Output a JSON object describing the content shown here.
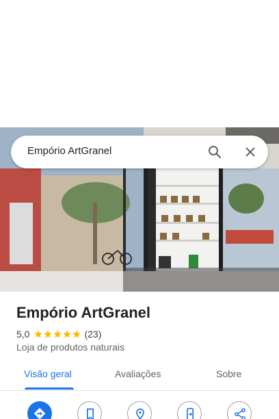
{
  "search": {
    "query": "Empório ArtGranel"
  },
  "place": {
    "name": "Empório ArtGranel",
    "rating": "5,0",
    "rating_value": 5,
    "review_count": "(23)",
    "category": "Loja de produtos naturais"
  },
  "tabs": [
    {
      "label": "Visão geral",
      "active": true
    },
    {
      "label": "Avaliações",
      "active": false
    },
    {
      "label": "Sobre",
      "active": false
    }
  ],
  "actions": [
    {
      "icon": "directions-icon"
    },
    {
      "icon": "bookmark-icon"
    },
    {
      "icon": "nearby-icon"
    },
    {
      "icon": "send-to-phone-icon"
    },
    {
      "icon": "share-icon"
    }
  ],
  "colors": {
    "accent": "#1a73e8",
    "star": "#fbbc04",
    "text": "#202124",
    "secondary_text": "#5f6368"
  }
}
